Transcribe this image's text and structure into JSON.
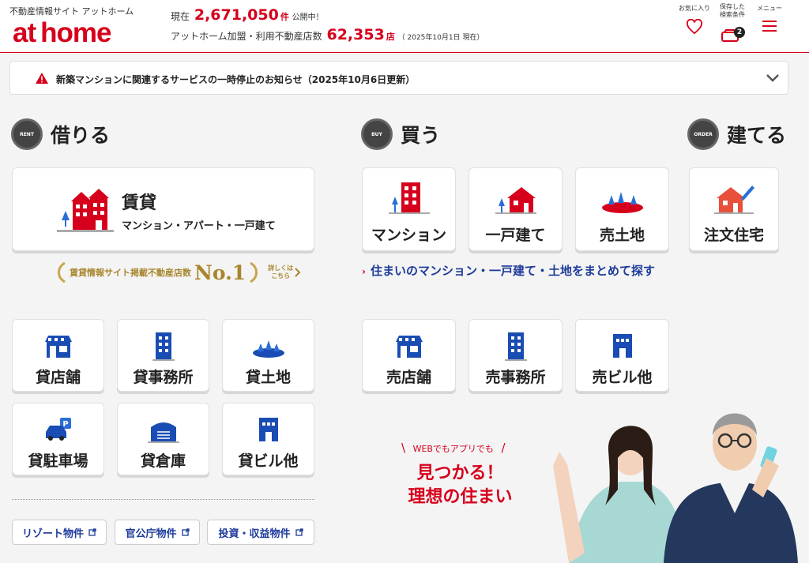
{
  "header": {
    "tagline": "不動産情報サイト アットホーム",
    "logo": "at home",
    "stats1_prefix": "現在",
    "stats1_value": "2,671,050",
    "stats1_unit": "件",
    "stats1_suffix": "公開中！",
    "stats2_prefix": "アットホーム加盟・利用不動産店数",
    "stats2_value": "62,353",
    "stats2_unit": "店",
    "stats2_note": "（ 2025年10月1日 現在）",
    "nav": [
      {
        "label": "お気に入り",
        "icon": "heart-icon"
      },
      {
        "label": "保存した 検索条件",
        "icon": "saved-search-icon",
        "badge": "2"
      },
      {
        "label": "メニュー",
        "icon": "hamburger-icon"
      }
    ]
  },
  "notice": {
    "text": "新築マンションに関連するサービスの一時停止のお知らせ（2025年10月6日更新）"
  },
  "rent": {
    "title": "借りる",
    "badge": "RENT",
    "main_card": {
      "label": "賃貸",
      "sub": "マンション・アパート・一戸建て"
    },
    "no1": {
      "text": "賃貸情報サイト掲載不動産店数",
      "rank": "No.1",
      "detail": "詳しくは こちら"
    },
    "cards": [
      "貸店舗",
      "貸事務所",
      "貸土地",
      "貸駐車場",
      "貸倉庫",
      "貸ビル他"
    ],
    "links": [
      "リゾート物件",
      "官公庁物件",
      "投資・収益物件"
    ]
  },
  "buy": {
    "title": "買う",
    "badge": "BUY",
    "cards": [
      "マンション",
      "一戸建て",
      "売土地"
    ],
    "link": "住まいのマンション・一戸建て・土地をまとめて探す",
    "cards2": [
      "売店舗",
      "売事務所",
      "売ビル他"
    ]
  },
  "build": {
    "title": "建てる",
    "badge": "ORDER",
    "cards": [
      "注文住宅"
    ]
  },
  "promo": {
    "small": "WEBでもアプリでも",
    "line1": "見つかる！",
    "line2": "理想の住まい"
  },
  "colors": {
    "brand": "#d6001c",
    "link": "#1d3b9b",
    "icon_blue": "#1a4db3",
    "gold": "#a8862c"
  }
}
